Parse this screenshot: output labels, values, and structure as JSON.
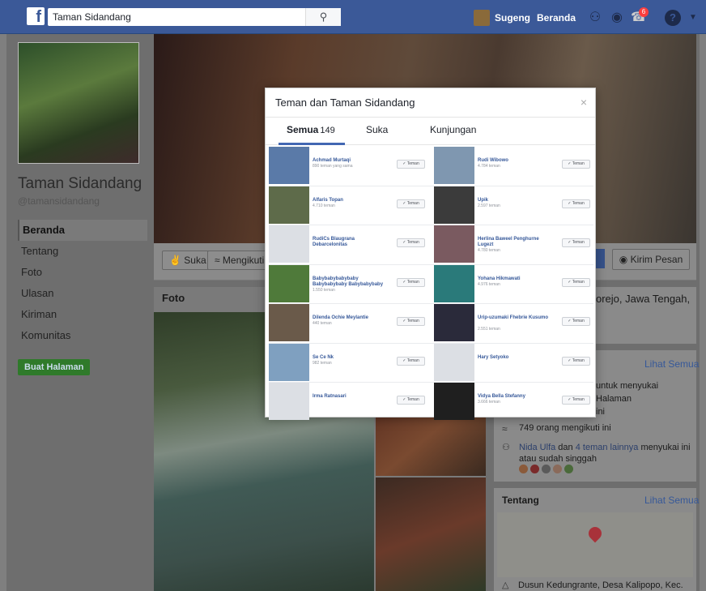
{
  "topbar": {
    "logo": "f",
    "search_value": "Taman Sidandang",
    "user_name": "Sugeng",
    "home_label": "Beranda",
    "notif_count": "6",
    "help_icon": "?"
  },
  "sidebar": {
    "page_name": "Taman Sidandang",
    "handle": "@tamansidandang",
    "items": [
      {
        "label": "Beranda",
        "active": true
      },
      {
        "label": "Tentang"
      },
      {
        "label": "Foto"
      },
      {
        "label": "Ulasan"
      },
      {
        "label": "Kiriman"
      },
      {
        "label": "Komunitas"
      }
    ],
    "create_button": "Buat Halaman"
  },
  "actions": {
    "like": "Suka",
    "follow": "Mengikuti",
    "message": "Kirim Pesan"
  },
  "photos": {
    "title": "Foto"
  },
  "location": {
    "text": "orejo, Jawa Tengah,"
  },
  "community": {
    "see_all": "Lihat Semua",
    "line1": "untuk menyukai Halaman",
    "line2": "ini",
    "line3": "ini",
    "followers": "749 orang mengikuti ini",
    "likes_prefix": "Nida Ulfa",
    "likes_mid": " dan ",
    "likes_link": "4 teman lainnya",
    "likes_suffix": " menyukai ini atau sudah singgah"
  },
  "about": {
    "title": "Tentang",
    "see_all": "Lihat Semua",
    "address": "Dusun Kedungrante, Desa Kalipopo, Kec."
  },
  "modal": {
    "title": "Teman dan Taman Sidandang",
    "close": "×",
    "tabs": [
      {
        "label": "Semua",
        "count": "149"
      },
      {
        "label": "Suka"
      },
      {
        "label": "Kunjungan"
      }
    ],
    "friend_button": "✓ Teman",
    "friends": [
      {
        "name": "Achmad Murtaqi",
        "sub": "890 teman yang sama",
        "color": "#5a7aa8"
      },
      {
        "name": "Rudi Wibowo",
        "sub": "4.784 teman",
        "color": "#7f97b0"
      },
      {
        "name": "Alfaris Topan",
        "sub": "4.710 teman",
        "color": "#5e6b4a"
      },
      {
        "name": "Upik",
        "sub": "2.597 teman",
        "color": "#3b3b3b"
      },
      {
        "name": "RudiCs Blaugrana Debarcelonitas",
        "sub": "",
        "color": "#dcdfe4"
      },
      {
        "name": "Herlina Baweel Penghurne Lugezt",
        "sub": "4.780 teman",
        "color": "#7a5a60"
      },
      {
        "name": "Babybabybabybaby Babybabybaby Babybabybaby",
        "sub": "1.550 teman",
        "color": "#4f7a3a"
      },
      {
        "name": "Yohana Hikmawati",
        "sub": "4.976 teman",
        "color": "#2a7a7a"
      },
      {
        "name": "Dilenda Ochie Meylantie",
        "sub": "440 teman",
        "color": "#6a5a4a"
      },
      {
        "name": "Urip-uzumaki Fhebrie Kusumo",
        "sub": "2.551 teman",
        "color": "#2a2a3a"
      },
      {
        "name": "Se Ce Nk",
        "sub": "982 teman",
        "color": "#7fa0c0"
      },
      {
        "name": "Hary Setyoko",
        "sub": "",
        "color": "#dcdfe4"
      },
      {
        "name": "Irma Ratnasari",
        "sub": "",
        "color": "#dcdfe4"
      },
      {
        "name": "Vidya Bella Stefanny",
        "sub": "3.666 teman",
        "color": "#1f1f1f"
      }
    ]
  }
}
